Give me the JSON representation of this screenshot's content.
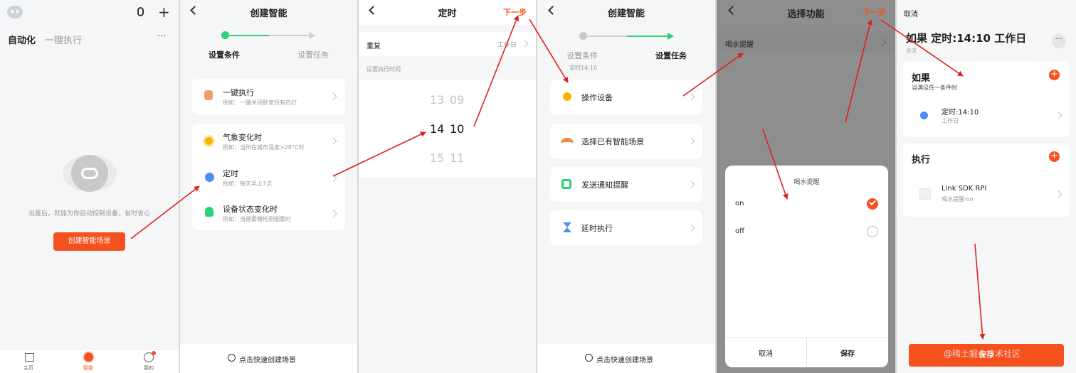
{
  "p1": {
    "tab_automation": "自动化",
    "tab_oneclick": "一键执行",
    "more": "···",
    "empty_text": "设置后，就能为你自动控制设备，省时省心",
    "create_button": "创建智能场景",
    "nav": [
      {
        "label": "主页"
      },
      {
        "label": "智能"
      },
      {
        "label": "我的"
      }
    ]
  },
  "p2": {
    "title": "创建智能",
    "step1": "设置条件",
    "step2": "设置任务",
    "items": [
      {
        "title": "一键执行",
        "sub": "例如：一键关闭卧室所有的灯"
      },
      {
        "title": "气象变化时",
        "sub": "例如：当所在城市温度>28°C时"
      },
      {
        "title": "定时",
        "sub": "例如：每天早上7点"
      },
      {
        "title": "设备状态变化时",
        "sub": "例如：当烟雾器检测烟雾时"
      }
    ],
    "footer": "点击快速创建场景"
  },
  "p3": {
    "title": "定时",
    "next": "下一步",
    "repeat_label": "重复",
    "repeat_value": "工作日",
    "section": "设置执行时间",
    "rows": [
      {
        "h": "13",
        "m": "09"
      },
      {
        "h": "14",
        "m": "10"
      },
      {
        "h": "15",
        "m": "11"
      }
    ]
  },
  "p4": {
    "title": "创建智能",
    "step1": "设置条件",
    "step1_sub": "定时14:10",
    "step2": "设置任务",
    "items": [
      {
        "title": "操作设备"
      },
      {
        "title": "选择已有智能场景"
      },
      {
        "title": "发送通知提醒"
      },
      {
        "title": "延时执行"
      }
    ],
    "footer": "点击快速创建场景"
  },
  "p5": {
    "title": "选择功能",
    "next": "下一步",
    "function_item": "喝水提醒",
    "sheet_title": "喝水提醒",
    "option_on": "on",
    "option_off": "off",
    "cancel": "取消",
    "save": "保存"
  },
  "p6": {
    "cancel": "取消",
    "scene_title": "如果 定时:14:10 工作日",
    "scene_sub": "全天",
    "if_title": "如果",
    "if_sub": "当满足任一条件时",
    "cond_title": "定时:14:10",
    "cond_sub": "工作日",
    "exec_title": "执行",
    "task_title": "Link SDK RPI",
    "task_sub": "喝水提醒:on",
    "save_btn": "保存",
    "watermark": "@稀土掘金技术社区"
  },
  "colors": {
    "accent": "#f4511e",
    "green": "#2ecf7a",
    "blue": "#4a8ff0"
  }
}
